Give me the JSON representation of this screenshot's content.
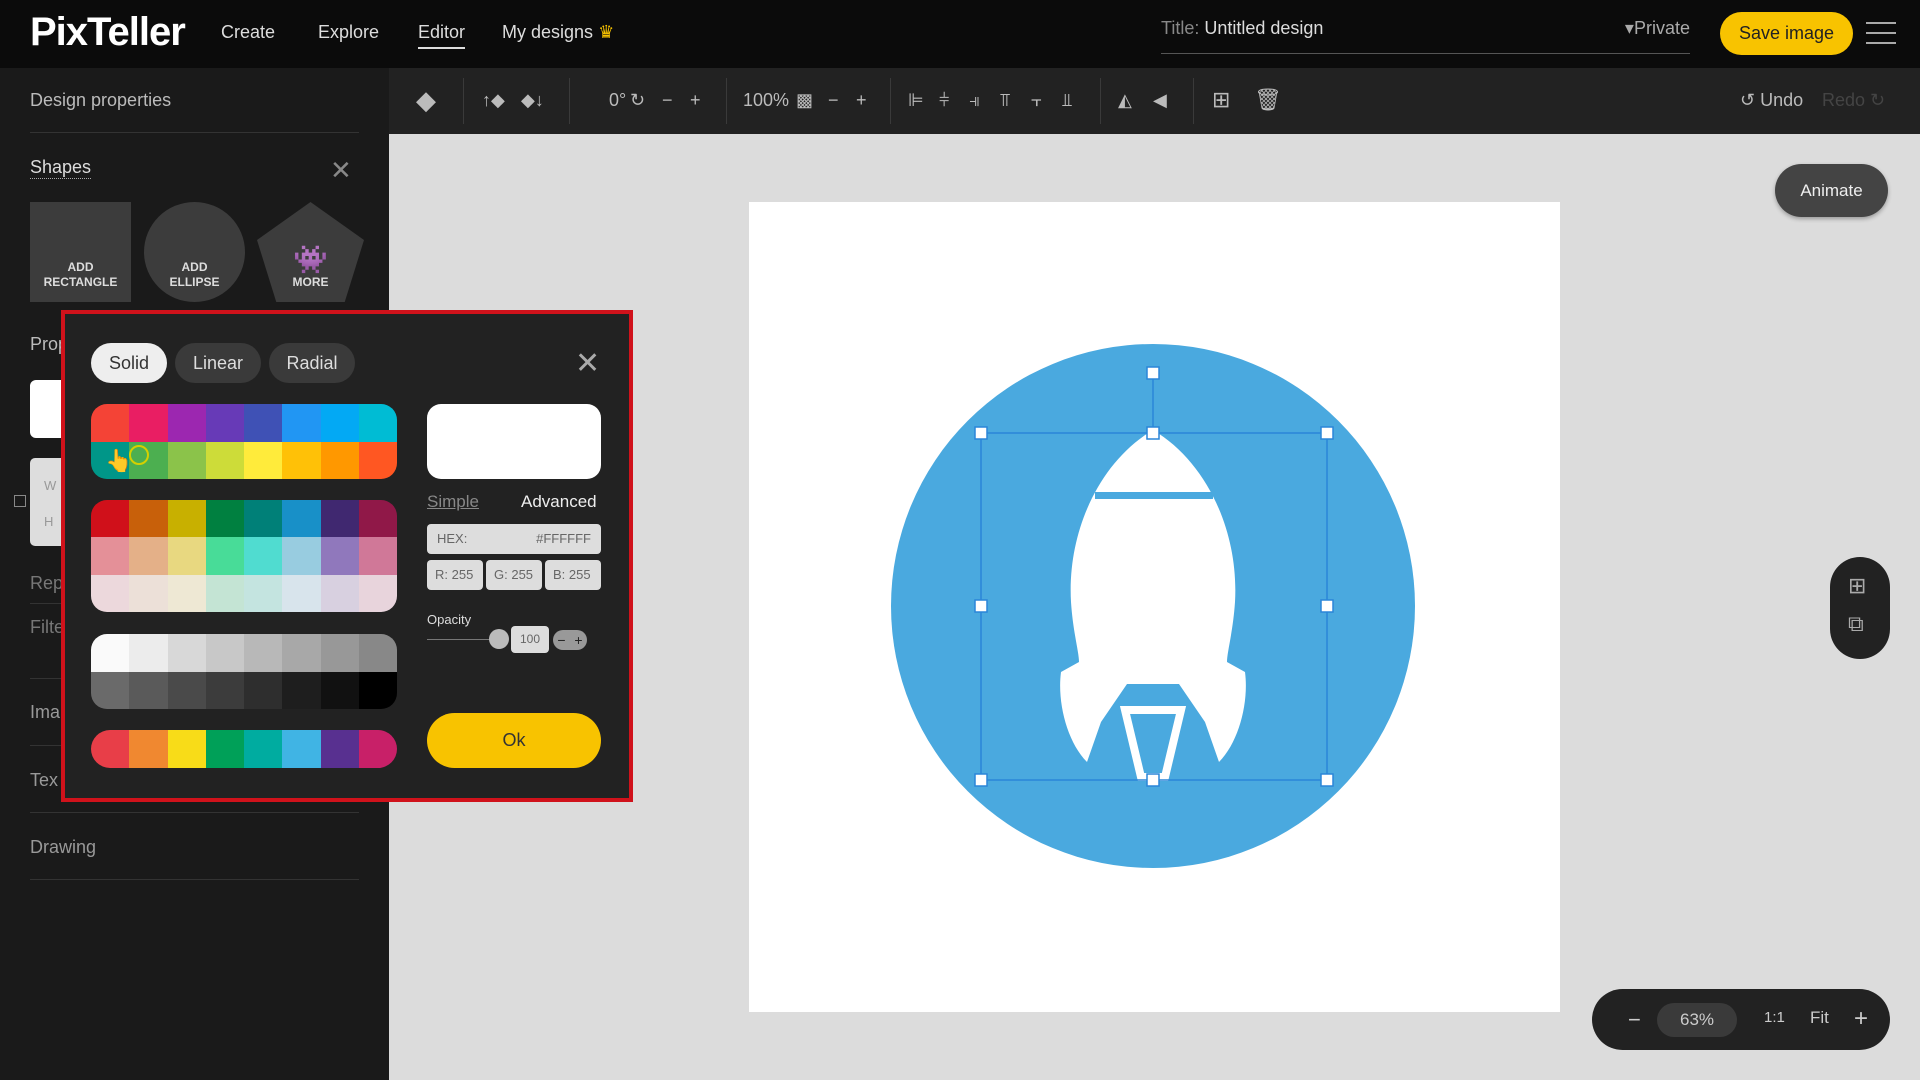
{
  "header": {
    "logo": "PixTeller",
    "nav": [
      {
        "label": "Create"
      },
      {
        "label": "Explore"
      },
      {
        "label": "Editor",
        "active": true
      },
      {
        "label": "My designs"
      }
    ],
    "title_label": "Title:",
    "title_value": "Untitled design",
    "privacy": "Private",
    "save_label": "Save image"
  },
  "toolbar": {
    "rotation": "0°",
    "zoom": "100%",
    "undo": "Undo",
    "redo": "Redo"
  },
  "sidebar": {
    "design_properties": "Design properties",
    "shapes_title": "Shapes",
    "add_rectangle": [
      "ADD",
      "RECTANGLE"
    ],
    "add_ellipse": [
      "ADD",
      "ELLIPSE"
    ],
    "more": "MORE",
    "sections_partial": [
      "Prop",
      "Rep",
      "Filte",
      "Ima",
      "Tex"
    ],
    "drawing": "Drawing",
    "dims_partial": [
      "W",
      "H"
    ]
  },
  "color_picker": {
    "tabs": [
      "Solid",
      "Linear",
      "Radial"
    ],
    "selected_tab": "Solid",
    "mode_simple": "Simple",
    "mode_advanced": "Advanced",
    "hex_label": "HEX:",
    "hex_value": "#FFFFFF",
    "r": "R: 255",
    "g": "G: 255",
    "b": "B: 255",
    "opacity_label": "Opacity",
    "opacity_value": "100",
    "ok_label": "Ok",
    "preview_color": "#FFFFFF",
    "palettes": [
      [
        [
          "#f44336",
          "#e91e63",
          "#9c27b0",
          "#673ab7",
          "#3f51b5",
          "#2196f3",
          "#03a9f4",
          "#00bcd4"
        ],
        [
          "#009688",
          "#4caf50",
          "#8bc34a",
          "#cddc39",
          "#ffeb3b",
          "#ffc107",
          "#ff9800",
          "#ff5722"
        ]
      ],
      [
        [
          "#d0101a",
          "#c8600a",
          "#c8b000",
          "#008040",
          "#008078",
          "#1890c8",
          "#402870",
          "#901848"
        ],
        [
          "#e49098",
          "#e4b088",
          "#e8d880",
          "#48dc98",
          "#50dcd0",
          "#98cce0",
          "#9078bc",
          "#d07898"
        ],
        [
          "#ecd8dc",
          "#ece0d8",
          "#eee8d4",
          "#c4e4d4",
          "#c4e4e0",
          "#d8e4ec",
          "#d8d0e0",
          "#e8d4dc"
        ]
      ],
      [
        [
          "#fafafa",
          "#ececec",
          "#d8d8d8",
          "#c8c8c8",
          "#b8b8b8",
          "#a8a8a8",
          "#989898",
          "#888888"
        ],
        [
          "#6a6a6a",
          "#5a5a5a",
          "#4a4a4a",
          "#3c3c3c",
          "#2e2e2e",
          "#1e1e1e",
          "#111111",
          "#000000"
        ]
      ],
      [
        [
          "#e83e48",
          "#f08830",
          "#f8dc18",
          "#00a058",
          "#00aca0",
          "#40b4e4",
          "#583090",
          "#c82068"
        ]
      ]
    ]
  },
  "canvas": {
    "animate_label": "Animate",
    "circle_color": "#4aa9df",
    "zoom_value": "63%",
    "one_to_one": "1:1",
    "fit": "Fit"
  },
  "colors": {
    "accent": "#f8c300",
    "highlight_border": "#d0121b"
  }
}
